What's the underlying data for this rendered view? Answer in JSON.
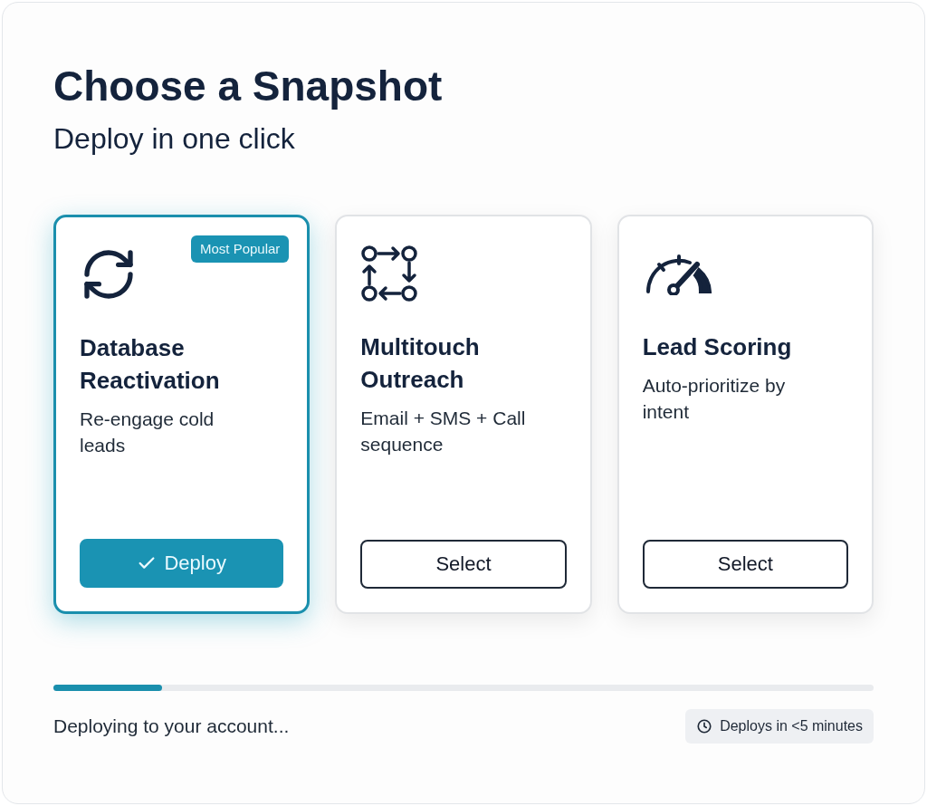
{
  "title": "Choose a Snapshot",
  "subtitle": "Deploy in one click",
  "cards": [
    {
      "kind": "refresh",
      "title": "Database Reactivation",
      "description": "Re-engage cold leads",
      "badge": "Most Popular",
      "selected": true,
      "button": "Deploy"
    },
    {
      "kind": "flow",
      "title": "Multitouch Outreach",
      "description": "Email + SMS + Call sequence",
      "selected": false,
      "button": "Select"
    },
    {
      "kind": "gauge",
      "title": "Lead Scoring",
      "description": "Auto-prioritize by intent",
      "selected": false,
      "button": "Select"
    }
  ],
  "progress": {
    "level": 0.133,
    "status": "Deploying to your account...",
    "eta": "Deploys in <5 minutes"
  }
}
